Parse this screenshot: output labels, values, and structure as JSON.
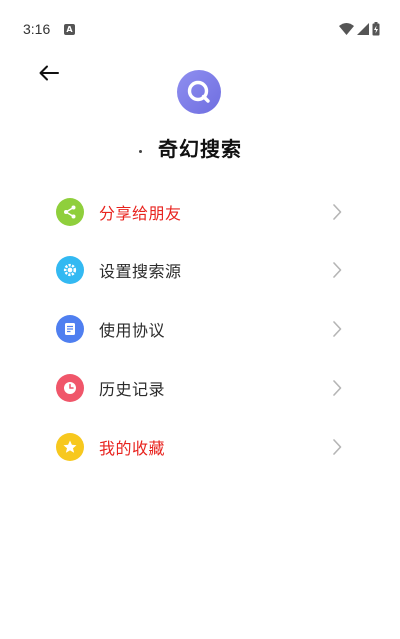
{
  "status_bar": {
    "time": "3:16",
    "notification_letter": "A"
  },
  "header": {
    "title": "奇幻搜索"
  },
  "menu": {
    "items": [
      {
        "label": "分享给朋友",
        "icon": "share-icon",
        "icon_color": "#8fcf3c",
        "label_color": "#e8241f"
      },
      {
        "label": "设置搜索源",
        "icon": "gear-icon",
        "icon_color": "#33b9f2",
        "label_color": "#2b2b2b"
      },
      {
        "label": "使用协议",
        "icon": "document-icon",
        "icon_color": "#4f7ff0",
        "label_color": "#2b2b2b"
      },
      {
        "label": "历史记录",
        "icon": "clock-icon",
        "icon_color": "#f0566a",
        "label_color": "#2b2b2b"
      },
      {
        "label": "我的收藏",
        "icon": "star-icon",
        "icon_color": "#f7c81e",
        "label_color": "#e8241f"
      }
    ]
  },
  "colors": {
    "accent_purple": "#7b7be8",
    "highlight_red": "#e8241f",
    "text_dark": "#2b2b2b",
    "chevron_gray": "#b5b5b5"
  }
}
